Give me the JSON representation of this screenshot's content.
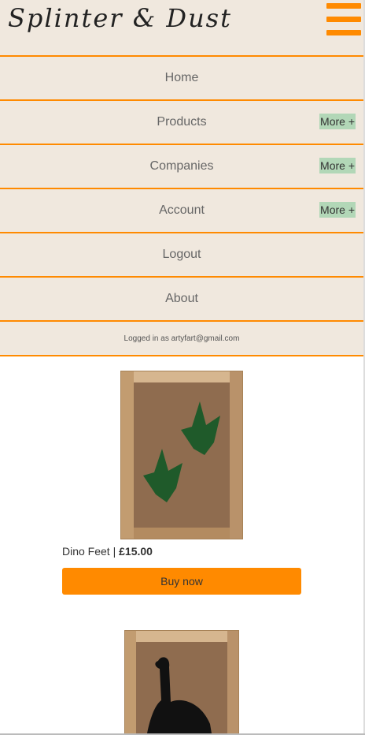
{
  "header": {
    "logo_text": "Splinter & Dust",
    "menu_icon": "hamburger-menu-icon",
    "accent_color": "#ff8a00",
    "background_color": "#f0e8de"
  },
  "nav": {
    "items": [
      {
        "label": "Home"
      },
      {
        "label": "Products",
        "more": "More +"
      },
      {
        "label": "Companies",
        "more": "More +"
      },
      {
        "label": "Account",
        "more": "More +"
      },
      {
        "label": "Logout"
      },
      {
        "label": "About"
      }
    ],
    "status": "Logged in as artyfart@gmail.com"
  },
  "products": [
    {
      "name": "Dino Feet",
      "separator": " | ",
      "price": "£15.00",
      "button": "Buy now",
      "image": "framed-dinosaur-footprints-artwork"
    },
    {
      "image": "framed-dinosaur-silhouette-artwork"
    }
  ]
}
